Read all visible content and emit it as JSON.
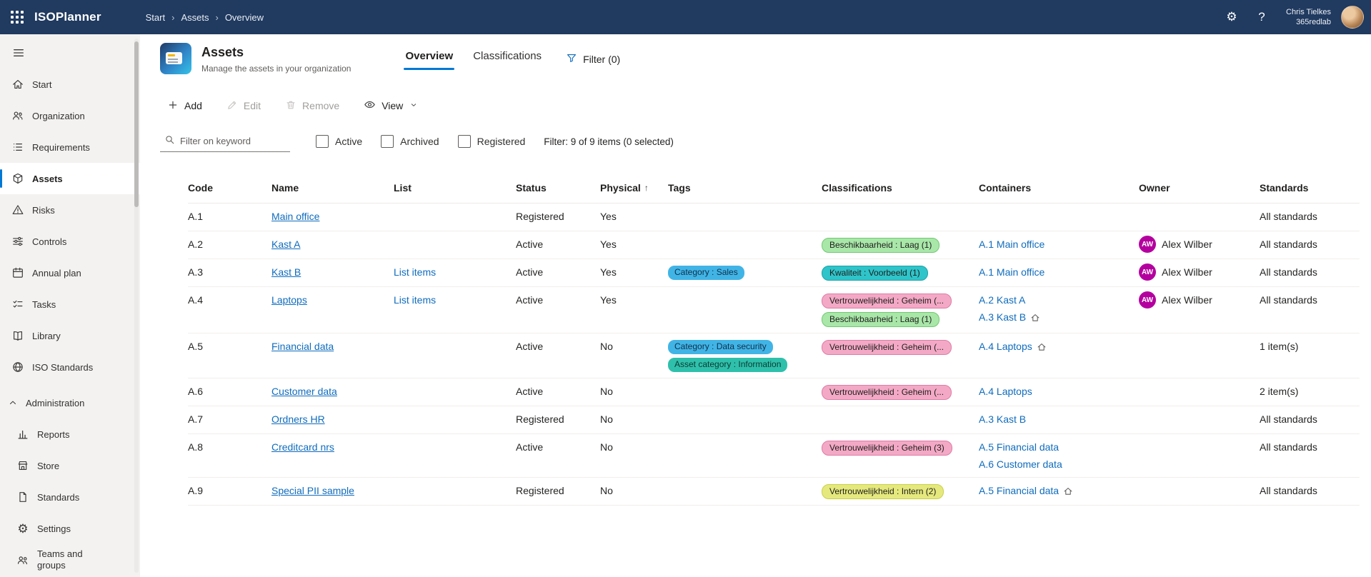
{
  "colors": {
    "topbar_bg": "#203a60",
    "accent": "#0078d4",
    "sidebar_bg": "#f3f2f1",
    "link": "#0f6cbd",
    "pill_green_bg": "#a9e7a9",
    "pill_green_border": "#71c871",
    "pill_teal_bg": "#2fc4c9",
    "pill_teal_border": "#1ba3a8",
    "pill_pink_bg": "#f3a9c5",
    "pill_pink_border": "#df7ba5",
    "pill_yellow_bg": "#e5e97d",
    "pill_yellow_border": "#c9cf49",
    "tag_blue_bg": "#41b4e6",
    "tag_teal_bg": "#2fc0ab",
    "avatar_bg": "#b4009e"
  },
  "topbar": {
    "app_title": "ISOPlanner",
    "breadcrumb": [
      "Start",
      "Assets",
      "Overview"
    ],
    "icons": [
      "app-launcher",
      "settings-gear",
      "help"
    ],
    "user": {
      "name": "Chris Tielkes",
      "org": "365redlab"
    }
  },
  "sidebar": {
    "items": [
      {
        "label": "Start",
        "icon": "home"
      },
      {
        "label": "Organization",
        "icon": "people"
      },
      {
        "label": "Requirements",
        "icon": "bulleted-list"
      },
      {
        "label": "Assets",
        "icon": "cube",
        "selected": true
      },
      {
        "label": "Risks",
        "icon": "warning"
      },
      {
        "label": "Controls",
        "icon": "sliders"
      },
      {
        "label": "Annual plan",
        "icon": "calendar"
      },
      {
        "label": "Tasks",
        "icon": "task-checklist"
      },
      {
        "label": "Library",
        "icon": "book"
      },
      {
        "label": "ISO Standards",
        "icon": "globe"
      }
    ],
    "admin_section": {
      "label": "Administration",
      "expanded": true,
      "items": [
        {
          "label": "Reports",
          "icon": "bar-chart"
        },
        {
          "label": "Store",
          "icon": "storefront"
        },
        {
          "label": "Standards",
          "icon": "document"
        },
        {
          "label": "Settings",
          "icon": "gear"
        },
        {
          "label": "Teams and groups",
          "icon": "people-team"
        }
      ]
    }
  },
  "header": {
    "title": "Assets",
    "subtitle": "Manage the assets in your organization",
    "tabs": [
      {
        "label": "Overview",
        "active": true
      },
      {
        "label": "Classifications",
        "active": false
      }
    ],
    "filter_button": "Filter (0)"
  },
  "toolbar": {
    "add": "Add",
    "edit": "Edit",
    "remove": "Remove",
    "view": "View"
  },
  "filters": {
    "search_placeholder": "Filter on keyword",
    "checkboxes": [
      "Active",
      "Archived",
      "Registered"
    ],
    "summary": "Filter: 9 of 9 items (0 selected)"
  },
  "table": {
    "columns": [
      "Code",
      "Name",
      "List",
      "Status",
      "Physical",
      "Tags",
      "Classifications",
      "Containers",
      "Owner",
      "Standards"
    ],
    "sort": {
      "column": "Physical",
      "direction": "asc"
    },
    "rows": [
      {
        "code": "A.1",
        "name": "Main office",
        "list": "",
        "status": "Registered",
        "physical": "Yes",
        "tags": [],
        "classifications": [],
        "containers": [],
        "owner": null,
        "standards": "All standards"
      },
      {
        "code": "A.2",
        "name": "Kast A",
        "list": "",
        "status": "Active",
        "physical": "Yes",
        "tags": [],
        "classifications": [
          {
            "label": "Beschikbaarheid : Laag (1)",
            "color": "green"
          }
        ],
        "containers": [
          {
            "label": "A.1 Main office",
            "home": false
          }
        ],
        "owner": {
          "initials": "AW",
          "name": "Alex Wilber"
        },
        "standards": "All standards"
      },
      {
        "code": "A.3",
        "name": "Kast B",
        "list": "List items",
        "status": "Active",
        "physical": "Yes",
        "tags": [
          {
            "label": "Category : Sales",
            "color": "blue"
          }
        ],
        "classifications": [
          {
            "label": "Kwaliteit : Voorbeeld (1)",
            "color": "teal"
          }
        ],
        "containers": [
          {
            "label": "A.1 Main office",
            "home": false
          }
        ],
        "owner": {
          "initials": "AW",
          "name": "Alex Wilber"
        },
        "standards": "All standards"
      },
      {
        "code": "A.4",
        "name": "Laptops",
        "list": "List items",
        "status": "Active",
        "physical": "Yes",
        "tags": [],
        "classifications": [
          {
            "label": "Vertrouwelijkheid : Geheim (...",
            "color": "pink"
          },
          {
            "label": "Beschikbaarheid : Laag (1)",
            "color": "green"
          }
        ],
        "containers": [
          {
            "label": "A.2 Kast A",
            "home": false
          },
          {
            "label": "A.3 Kast B",
            "home": true
          }
        ],
        "owner": {
          "initials": "AW",
          "name": "Alex Wilber"
        },
        "standards": "All standards"
      },
      {
        "code": "A.5",
        "name": "Financial data",
        "list": "",
        "status": "Active",
        "physical": "No",
        "tags": [
          {
            "label": "Category : Data security",
            "color": "blue"
          },
          {
            "label": "Asset category : Information",
            "color": "teal"
          }
        ],
        "classifications": [
          {
            "label": "Vertrouwelijkheid : Geheim (...",
            "color": "pink"
          }
        ],
        "containers": [
          {
            "label": "A.4 Laptops",
            "home": true
          }
        ],
        "owner": null,
        "standards": "1 item(s)"
      },
      {
        "code": "A.6",
        "name": "Customer data",
        "list": "",
        "status": "Active",
        "physical": "No",
        "tags": [],
        "classifications": [
          {
            "label": "Vertrouwelijkheid : Geheim (...",
            "color": "pink"
          }
        ],
        "containers": [
          {
            "label": "A.4 Laptops",
            "home": false
          }
        ],
        "owner": null,
        "standards": "2 item(s)"
      },
      {
        "code": "A.7",
        "name": "Ordners HR",
        "list": "",
        "status": "Registered",
        "physical": "No",
        "tags": [],
        "classifications": [],
        "containers": [
          {
            "label": "A.3 Kast B",
            "home": false
          }
        ],
        "owner": null,
        "standards": "All standards"
      },
      {
        "code": "A.8",
        "name": "Creditcard nrs",
        "list": "",
        "status": "Active",
        "physical": "No",
        "tags": [],
        "classifications": [
          {
            "label": "Vertrouwelijkheid : Geheim (3)",
            "color": "pink"
          }
        ],
        "containers": [
          {
            "label": "A.5 Financial data",
            "home": false
          },
          {
            "label": "A.6 Customer data",
            "home": false
          }
        ],
        "owner": null,
        "standards": "All standards"
      },
      {
        "code": "A.9",
        "name": "Special PII sample",
        "list": "",
        "status": "Registered",
        "physical": "No",
        "tags": [],
        "classifications": [
          {
            "label": "Vertrouwelijkheid : Intern (2)",
            "color": "yellow"
          }
        ],
        "containers": [
          {
            "label": "A.5 Financial data",
            "home": true
          }
        ],
        "owner": null,
        "standards": "All standards"
      }
    ]
  }
}
